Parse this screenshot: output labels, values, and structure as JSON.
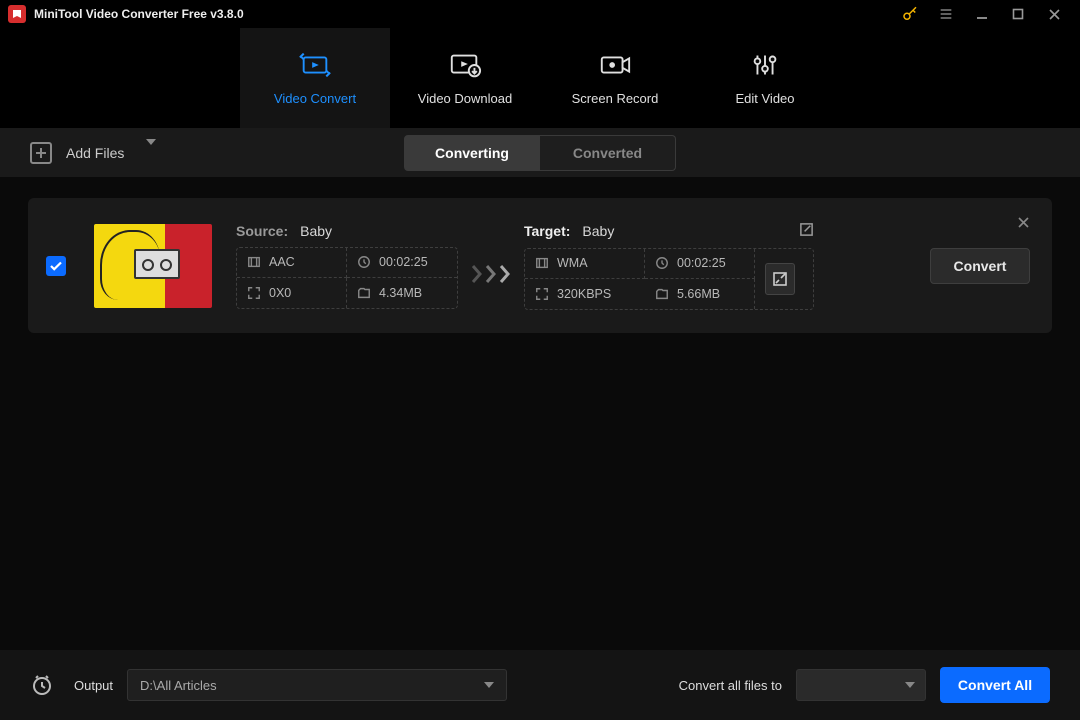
{
  "app": {
    "title": "MiniTool Video Converter Free v3.8.0"
  },
  "nav": {
    "tabs": [
      {
        "label": "Video Convert",
        "active": true
      },
      {
        "label": "Video Download",
        "active": false
      },
      {
        "label": "Screen Record",
        "active": false
      },
      {
        "label": "Edit Video",
        "active": false
      }
    ]
  },
  "toolbar": {
    "add_files": "Add Files",
    "seg_converting": "Converting",
    "seg_converted": "Converted"
  },
  "item": {
    "checked": true,
    "source": {
      "label": "Source:",
      "name": "Baby",
      "codec": "AAC",
      "duration": "00:02:25",
      "resolution": "0X0",
      "size": "4.34MB"
    },
    "target": {
      "label": "Target:",
      "name": "Baby",
      "codec": "WMA",
      "duration": "00:02:25",
      "bitrate": "320KBPS",
      "size": "5.66MB"
    },
    "convert_label": "Convert"
  },
  "footer": {
    "output_label": "Output",
    "output_path": "D:\\All Articles",
    "convert_all_files_to": "Convert all files to",
    "format_selected": "",
    "convert_all": "Convert All"
  }
}
